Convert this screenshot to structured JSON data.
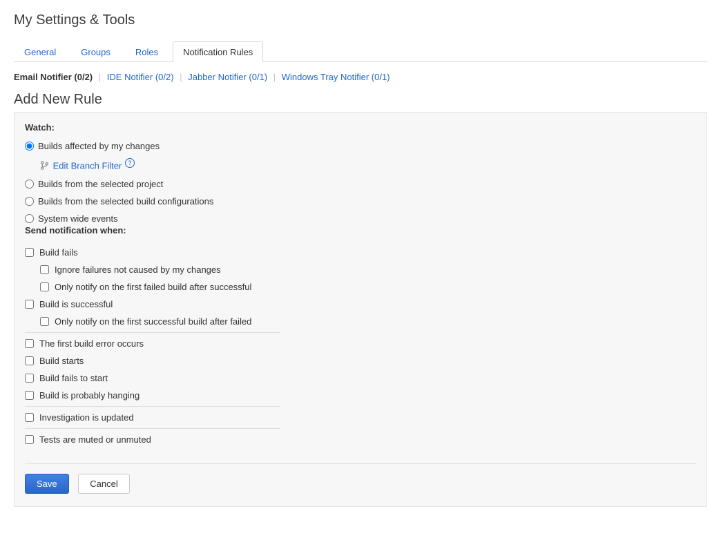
{
  "page_title": "My Settings & Tools",
  "tabs": {
    "general": "General",
    "groups": "Groups",
    "roles": "Roles",
    "notification_rules": "Notification Rules"
  },
  "notifiers": {
    "email": "Email Notifier (0/2)",
    "ide": "IDE Notifier (0/2)",
    "jabber": "Jabber Notifier (0/1)",
    "tray": "Windows Tray Notifier (0/1)"
  },
  "section_title": "Add New Rule",
  "watch_label": "Watch:",
  "watch_options": {
    "my_changes": "Builds affected by my changes",
    "project": "Builds from the selected project",
    "build_configs": "Builds from the selected build configurations",
    "system_wide": "System wide events"
  },
  "branch_filter": "Edit Branch Filter",
  "send_label": "Send notification when:",
  "events": {
    "build_fails": "Build fails",
    "ignore_failures": "Ignore failures not caused by my changes",
    "first_failed": "Only notify on the first failed build after successful",
    "build_success": "Build is successful",
    "first_success": "Only notify on the first successful build after failed",
    "first_error": "The first build error occurs",
    "build_starts": "Build starts",
    "fails_to_start": "Build fails to start",
    "hanging": "Build is probably hanging",
    "investigation": "Investigation is updated",
    "tests_muted": "Tests are muted or unmuted"
  },
  "buttons": {
    "save": "Save",
    "cancel": "Cancel"
  }
}
